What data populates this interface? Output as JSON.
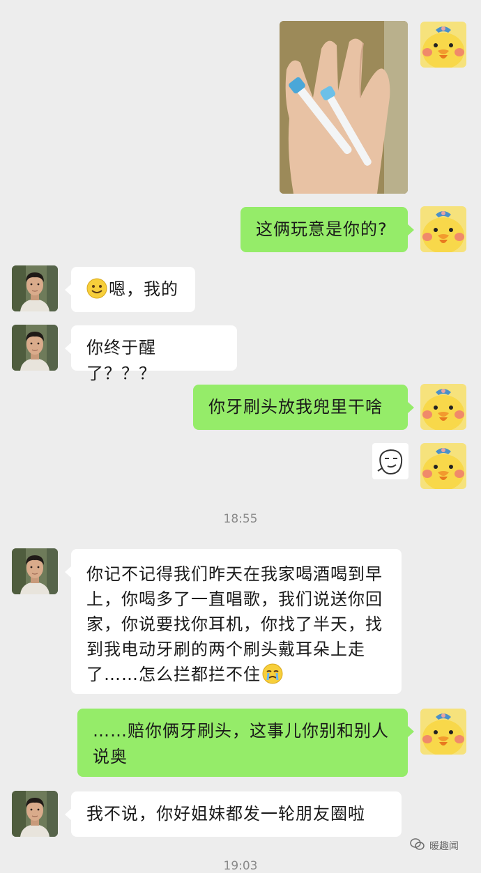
{
  "messages": {
    "m2": "这俩玩意是你的?",
    "m3": "嗯，我的",
    "m4": "你终于醒了？？？",
    "m5": "你牙刷头放我兜里干啥",
    "m7": "你记不记得我们昨天在我家喝酒喝到早上，你喝多了一直唱歌，我们说送你回家，你说要找你耳机，你找了半天，找到我电动牙刷的两个刷头戴耳朵上走了……怎么拦都拦不住",
    "m8": "……赔你俩牙刷头，这事儿你别和别人说奥",
    "m9": "我不说，你好姐妹都发一轮朋友圈啦"
  },
  "timestamps": {
    "t1": "18:55",
    "t2": "19:03"
  },
  "watermark": {
    "text": "暖趣闻"
  },
  "icons": {
    "self_avatar": "yellow-duck-avatar",
    "friend_avatar": "man-portrait-avatar",
    "photo": "toothbrush-heads-in-hand-photo",
    "sticker": "smirk-face-sticker",
    "smile_emoji": "smile-emoji",
    "cry_emoji": "crying-emoji",
    "watermark_icon": "wechat-logo-icon"
  },
  "colors": {
    "background": "#ededed",
    "self_bubble": "#95ec69",
    "friend_bubble": "#ffffff"
  }
}
